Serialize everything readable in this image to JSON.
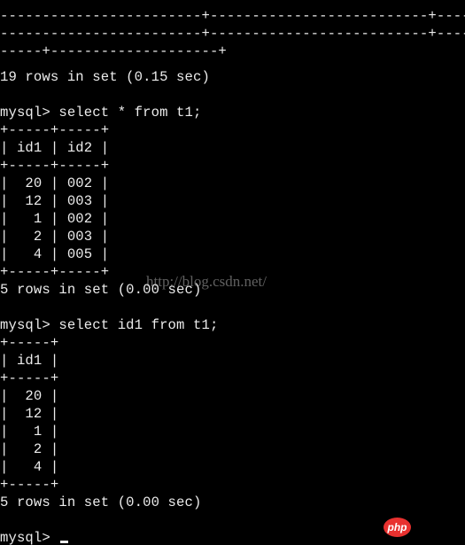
{
  "terminal": {
    "lines": [
      "------------------------------------------------------------",
      "------------------------+--------------------------+--------------",
      "------------------------+--------------------------+--------------",
      "-----+--------------------+",
      "19 rows in set (0.15 sec)",
      "",
      "mysql> select * from t1;",
      "+-----+-----+",
      "| id1 | id2 |",
      "+-----+-----+",
      "|  20 | 002 |",
      "|  12 | 003 |",
      "|   1 | 002 |",
      "|   2 | 003 |",
      "|   4 | 005 |",
      "+-----+-----+",
      "5 rows in set (0.00 sec)",
      "",
      "mysql> select id1 from t1;",
      "+-----+",
      "| id1 |",
      "+-----+",
      "|  20 |",
      "|  12 |",
      "|   1 |",
      "|   2 |",
      "|   4 |",
      "+-----+",
      "5 rows in set (0.00 sec)",
      "",
      "mysql> "
    ]
  },
  "watermark": "http://blog.csdn.net/",
  "logo": "php",
  "colors": {
    "background": "#000000",
    "text": "#ececec",
    "logo": "#e8312f"
  }
}
